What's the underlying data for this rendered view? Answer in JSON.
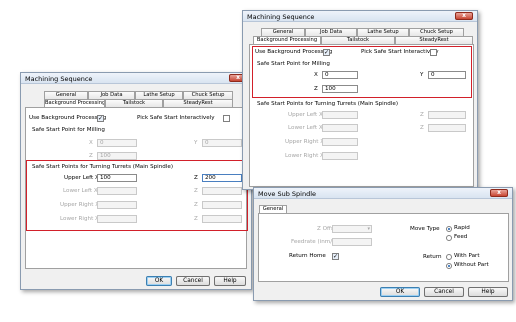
{
  "left_dialog": {
    "title": "Machining Sequence",
    "close": "x",
    "tabs_row1": [
      "General",
      "Job Data",
      "Lathe Setup",
      "Chuck Setup"
    ],
    "tabs_row2": [
      "Background Processing",
      "Tailstock",
      "SteadyRest"
    ],
    "use_background_processing": "Use Background Processing",
    "use_background_checked": "✓",
    "pick_safe_start": "Pick Safe Start Interactively",
    "milling_group": "Safe Start Point for Milling",
    "mill_x_label": "X",
    "mill_x_value": "0",
    "mill_y_label": "Y",
    "mill_y_value": "0",
    "mill_z_label": "Z",
    "mill_z_value": "100",
    "turning_group": "Safe Start Points for Turning Turrets (Main Spindle)",
    "upper_left_x": "Upper Left X",
    "upper_left_x_value": "100",
    "upper_left_z_label": "Z",
    "upper_left_z_value": "200",
    "lower_left_x": "Lower Left X",
    "upper_right_x": "Upper Right X",
    "lower_right_x": "Lower Right X",
    "z_label": "Z",
    "ok": "OK",
    "cancel": "Cancel",
    "help": "Help"
  },
  "right_dialog": {
    "title": "Machining Sequence",
    "close": "x",
    "tabs_row1": [
      "General",
      "Job Data",
      "Lathe Setup",
      "Chuck Setup"
    ],
    "tabs_row2": [
      "Background Processing",
      "Tailstock",
      "SteadyRest"
    ],
    "use_background_processing": "Use Background Processing",
    "use_background_checked": "✓",
    "pick_safe_start": "Pick Safe Start Interactively",
    "milling_group": "Safe Start Point for Milling",
    "mill_x_label": "X",
    "mill_x_value": "0",
    "mill_y_label": "Y",
    "mill_y_value": "0",
    "mill_z_label": "Z",
    "mill_z_value": "100",
    "turning_group": "Safe Start Points for Turning Turrets (Main Spindle)",
    "upper_left_x": "Upper Left X",
    "lower_left_x": "Lower Left X",
    "upper_right_x": "Upper Right X",
    "lower_right_x": "Lower Right X",
    "z_label": "Z"
  },
  "sub_spindle": {
    "title": "Move Sub Spindle",
    "close": "x",
    "tab": "General",
    "z_offset": "Z Offset",
    "feedrate": "Feedrate (inm/min)",
    "return_home": "Return Home",
    "return_home_checked": "✓",
    "move_type": "Move Type",
    "rapid": "Rapid",
    "feed": "Feed",
    "return": "Return",
    "with_part": "With Part",
    "without_part": "Without Part",
    "ok": "OK",
    "cancel": "Cancel",
    "help": "Help"
  },
  "colors": {
    "highlight": "#d2202a",
    "close": "#c84633"
  }
}
